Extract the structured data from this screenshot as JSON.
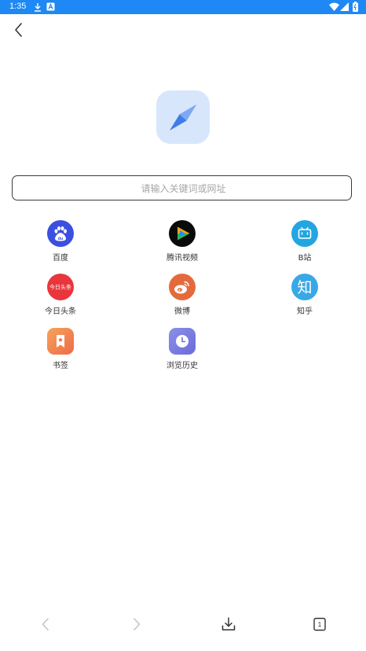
{
  "status_bar": {
    "time": "1:35"
  },
  "search": {
    "placeholder": "请输入关键词或网址",
    "value": ""
  },
  "shortcuts": [
    {
      "label": "百度",
      "icon": "baidu-icon",
      "color": "#3b4fe0"
    },
    {
      "label": "腾讯视频",
      "icon": "tencent-video-icon",
      "color": "#0a0a0a"
    },
    {
      "label": "B站",
      "icon": "bilibili-icon",
      "color": "#23a6e0"
    },
    {
      "label": "今日头条",
      "icon": "toutiao-icon",
      "icon_text": "今日头条",
      "color": "#e8363c"
    },
    {
      "label": "微博",
      "icon": "weibo-icon",
      "color": "#e46a3c"
    },
    {
      "label": "知乎",
      "icon": "zhihu-icon",
      "icon_text": "知",
      "color": "#39a8e6"
    },
    {
      "label": "书签",
      "icon": "bookmark-icon",
      "color": "#f2824a"
    },
    {
      "label": "浏览历史",
      "icon": "history-icon",
      "color": "#7e7fe0"
    }
  ],
  "bottom_nav": {
    "tab_count": "1"
  }
}
